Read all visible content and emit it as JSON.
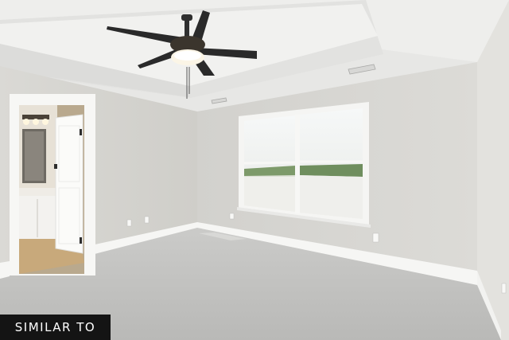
{
  "badge": {
    "label": "SIMILAR TO"
  },
  "colors": {
    "ceiling": "#e9e9e7",
    "ceiling_tray": "#f0f0ee",
    "wall_left": "#d6d5d1",
    "wall_back": "#d9d8d4",
    "wall_right": "#e0dfdb",
    "carpet": "#c3c3c1",
    "trim": "#f7f7f5",
    "window_glass": "#f4f6f6",
    "fan_blade": "#2a2a2a",
    "badge_bg": "#141414",
    "badge_text": "#ffffff"
  },
  "icons": [
    "ceiling-fan-icon",
    "window-icon",
    "door-icon",
    "outlet-icon",
    "vent-icon"
  ]
}
